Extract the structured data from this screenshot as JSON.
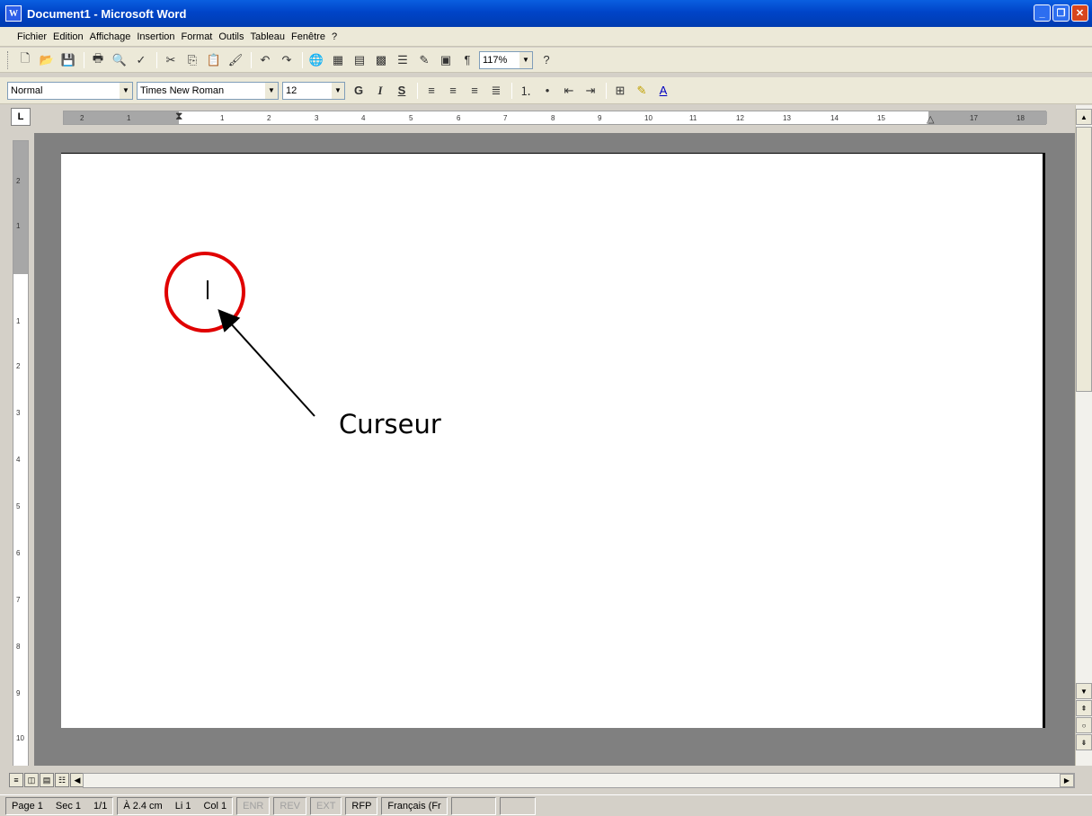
{
  "window": {
    "title": "Document1 - Microsoft Word",
    "app_icon": "W"
  },
  "menubar": {
    "items": [
      {
        "label": "Fichier"
      },
      {
        "label": "Edition"
      },
      {
        "label": "Affichage"
      },
      {
        "label": "Insertion"
      },
      {
        "label": "Format"
      },
      {
        "label": "Outils"
      },
      {
        "label": "Tableau"
      },
      {
        "label": "Fenêtre"
      },
      {
        "label": "?"
      }
    ]
  },
  "toolbar_standard": {
    "zoom": "117%"
  },
  "toolbar_formatting": {
    "style": "Normal",
    "font": "Times New Roman",
    "size": "12",
    "bold": "G",
    "italic": "I",
    "underline": "S"
  },
  "ruler": {
    "tab_selector": "L",
    "h_ticks": [
      "2",
      "1",
      "1",
      "2",
      "3",
      "4",
      "5",
      "6",
      "7",
      "8",
      "9",
      "10",
      "11",
      "12",
      "13",
      "14",
      "15",
      "17",
      "18"
    ],
    "v_ticks": [
      "2",
      "1",
      "1",
      "2",
      "3",
      "4",
      "5",
      "6",
      "7",
      "8",
      "9",
      "10"
    ]
  },
  "annotation": {
    "label": "Curseur",
    "color": "#e00000"
  },
  "statusbar": {
    "page": "Page 1",
    "section": "Sec 1",
    "pages": "1/1",
    "position": "À 2.4 cm",
    "line": "Li 1",
    "column": "Col 1",
    "enr": "ENR",
    "rev": "REV",
    "ext": "EXT",
    "rfp": "RFP",
    "language": "Français (Fr"
  }
}
